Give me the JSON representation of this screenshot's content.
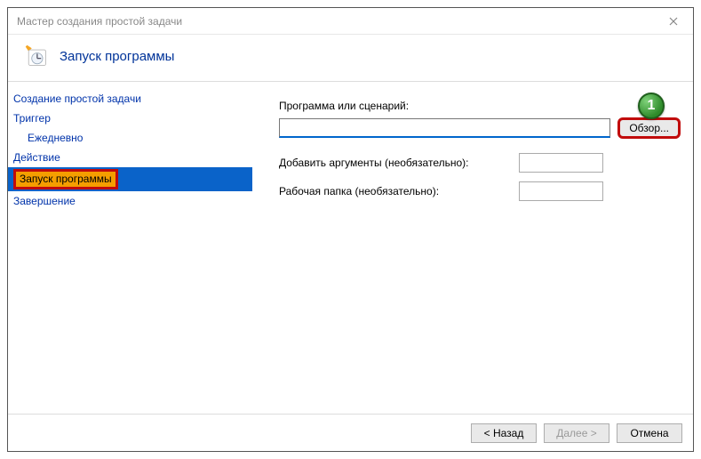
{
  "window": {
    "title": "Мастер создания простой задачи"
  },
  "header": {
    "title": "Запуск программы"
  },
  "sidebar": {
    "items": [
      {
        "label": "Создание простой задачи"
      },
      {
        "label": "Триггер"
      },
      {
        "label": "Ежедневно"
      },
      {
        "label": "Действие"
      },
      {
        "label": "Запуск программы"
      },
      {
        "label": "Завершение"
      }
    ]
  },
  "content": {
    "program_label": "Программа или сценарий:",
    "program_value": "",
    "browse_label": "Обзор...",
    "args_label": "Добавить аргументы (необязательно):",
    "args_value": "",
    "startin_label": "Рабочая папка (необязательно):",
    "startin_value": ""
  },
  "footer": {
    "back": "< Назад",
    "next": "Далее >",
    "cancel": "Отмена"
  },
  "callouts": {
    "browse": "1"
  }
}
